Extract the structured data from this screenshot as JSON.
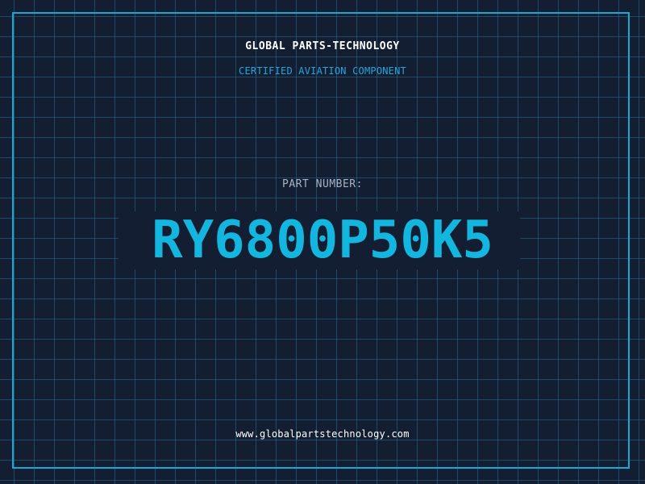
{
  "brand": {
    "name": "GLOBAL PARTS-TECHNOLOGY",
    "tagline": "CERTIFIED AVIATION COMPONENT"
  },
  "part": {
    "label": "PART NUMBER:",
    "number": "RY6800P50K5"
  },
  "footer": {
    "website": "www.globalpartstechnology.com"
  },
  "colors": {
    "background": "#141e33",
    "grid": "#2a6e8c",
    "frame": "#1aa7d4",
    "accent": "#12b6df",
    "text": "#ffffff",
    "muted": "#a7b2c2"
  }
}
